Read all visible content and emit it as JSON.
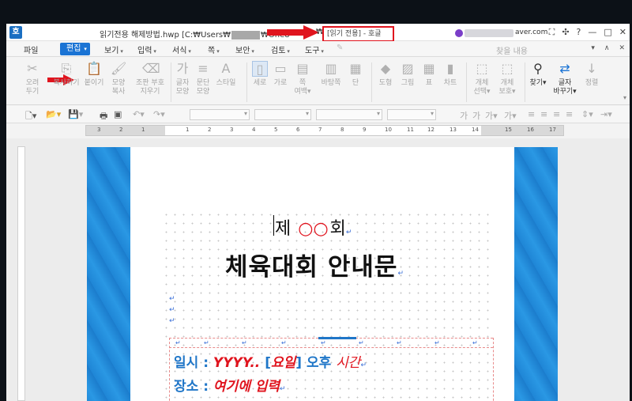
{
  "window": {
    "app_icon": "호",
    "title_prefix": "읽기전용 해제방법.hwp [C:₩Users₩",
    "title_mid": "₩One8",
    "title_tail": "₩",
    "readonly_tag": "[읽기 전용] - 호글",
    "user_domain": "aver.com",
    "buttons": [
      "⛶",
      "✣",
      "?",
      "—",
      "□",
      "✕"
    ]
  },
  "menu": {
    "file": "파일",
    "active": "편집",
    "items": [
      "보기",
      "입력",
      "서식",
      "쪽",
      "보안",
      "검토",
      "도구"
    ],
    "search_placeholder": "찾을 내용",
    "right": [
      "▾",
      "∧",
      "✕"
    ]
  },
  "ribbon": {
    "buttons": [
      {
        "label": "오려\n두기",
        "icon": "✂"
      },
      {
        "label": "복사하기",
        "icon": "⎘"
      },
      {
        "label": "붙이기",
        "icon": "📋"
      },
      {
        "label": "모양\n복사",
        "icon": "🖌"
      },
      {
        "label": "조판 부호\n지우기",
        "icon": "⌫"
      },
      {
        "label": "글자\n모양",
        "icon": "가"
      },
      {
        "label": "문단\n모양",
        "icon": "≡"
      },
      {
        "label": "스타일",
        "icon": "A"
      },
      {
        "label": "세로",
        "icon": "▯"
      },
      {
        "label": "가로",
        "icon": "▭"
      },
      {
        "label": "쪽\n여백",
        "icon": "▤"
      },
      {
        "label": "바탕쪽",
        "icon": "▥"
      },
      {
        "label": "단",
        "icon": "▦"
      },
      {
        "label": "도형",
        "icon": "◆"
      },
      {
        "label": "그림",
        "icon": "▨"
      },
      {
        "label": "표",
        "icon": "▦"
      },
      {
        "label": "차트",
        "icon": "▮"
      },
      {
        "label": "개체\n선택",
        "icon": "⬚"
      },
      {
        "label": "개체\n보호",
        "icon": "⬚"
      },
      {
        "label": "찾기",
        "icon": "⚲"
      },
      {
        "label": "글자\n바꾸기",
        "icon": "⇄"
      },
      {
        "label": "정렬",
        "icon": "↓"
      }
    ]
  },
  "ruler": {
    "numbers": [
      "3",
      "2",
      "1",
      "",
      "1",
      "2",
      "3",
      "4",
      "5",
      "6",
      "7",
      "8",
      "9",
      "10",
      "11",
      "12",
      "13",
      "14",
      "15",
      "16",
      "17"
    ]
  },
  "document": {
    "round_prefix": "제",
    "round_placeholder": "○○",
    "round_suffix": "회",
    "return_mark": "↵",
    "main_title": "체육대회 안내문",
    "date_label": "일시 : ",
    "date_value": "YYYY.. ",
    "date_bracket_open": "[",
    "date_day": "요일",
    "date_bracket_close": "]",
    "date_pm": " 오후 ",
    "date_time": "시간",
    "place_label": "장소 : ",
    "place_value": "여기에 입력"
  }
}
